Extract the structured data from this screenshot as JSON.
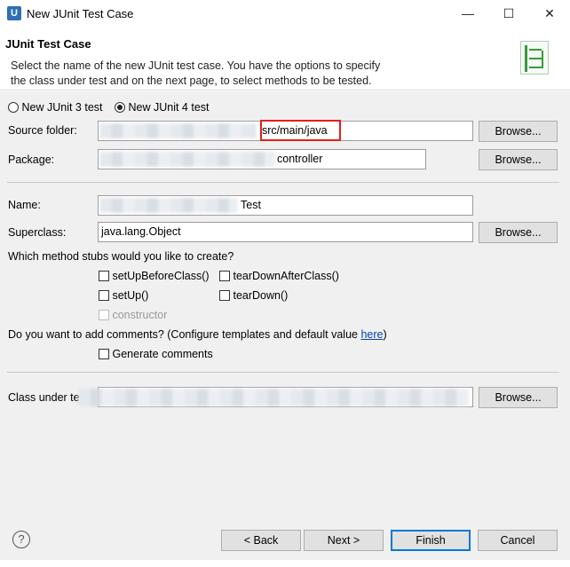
{
  "window": {
    "title": "New JUnit Test Case",
    "app_icon_letter": "U",
    "minimize_glyph": "—",
    "maximize_glyph": "☐",
    "close_glyph": "✕"
  },
  "banner": {
    "title": "JUnit Test Case",
    "description_line1": "Select the name of the new JUnit test case. You have the options to specify",
    "description_line2": "the class under test and on the next page, to select methods to be tested."
  },
  "junit_version": {
    "option3": "New JUnit 3 test",
    "option4": "New JUnit 4 test",
    "selected": "option4"
  },
  "source_folder": {
    "label": "Source folder:",
    "value": "src/main/java",
    "browse": "Browse..."
  },
  "package": {
    "label": "Package:",
    "value": "controller",
    "browse": "Browse..."
  },
  "name": {
    "label": "Name:",
    "value": "Test"
  },
  "superclass": {
    "label": "Superclass:",
    "value": "java.lang.Object",
    "browse": "Browse..."
  },
  "stubs": {
    "question": "Which method stubs would you like to create?",
    "setUpBeforeClass": "setUpBeforeClass()",
    "tearDownAfterClass": "tearDownAfterClass()",
    "setUp": "setUp()",
    "tearDown": "tearDown()",
    "constructor": "constructor"
  },
  "comments": {
    "question": "Do you want to add comments? (Configure templates and default value ",
    "link": "here",
    "close_paren": ")",
    "generate": "Generate comments"
  },
  "class_under_test": {
    "label": "Class under te",
    "browse": "Browse..."
  },
  "footer": {
    "help_glyph": "?",
    "back": "< Back",
    "next": "Next >",
    "finish": "Finish",
    "cancel": "Cancel"
  },
  "colors": {
    "highlight_border": "#e0201c",
    "link": "#0645ad"
  }
}
